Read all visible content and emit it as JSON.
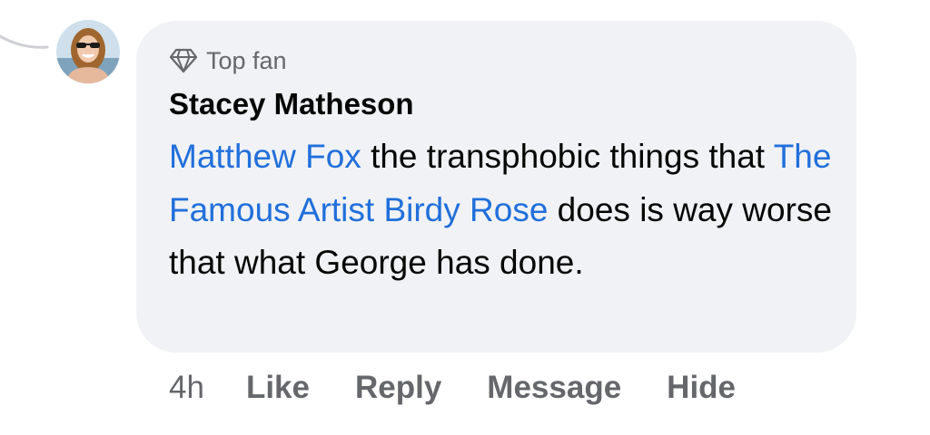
{
  "comment": {
    "badge": {
      "icon": "diamond-icon",
      "label": "Top fan"
    },
    "author": "Stacey Matheson",
    "body": {
      "mention_1": "Matthew Fox",
      "text_1": " the transphobic things that ",
      "mention_2": "The Famous Artist Birdy Rose",
      "text_2": " does is way worse that what George has done."
    },
    "timestamp": "4h",
    "actions": {
      "like": "Like",
      "reply": "Reply",
      "message": "Message",
      "hide": "Hide"
    }
  },
  "colors": {
    "bubble_background": "#f0f2f5",
    "mention_link": "#216fdb",
    "secondary_text": "#65676b",
    "primary_text": "#050505"
  }
}
